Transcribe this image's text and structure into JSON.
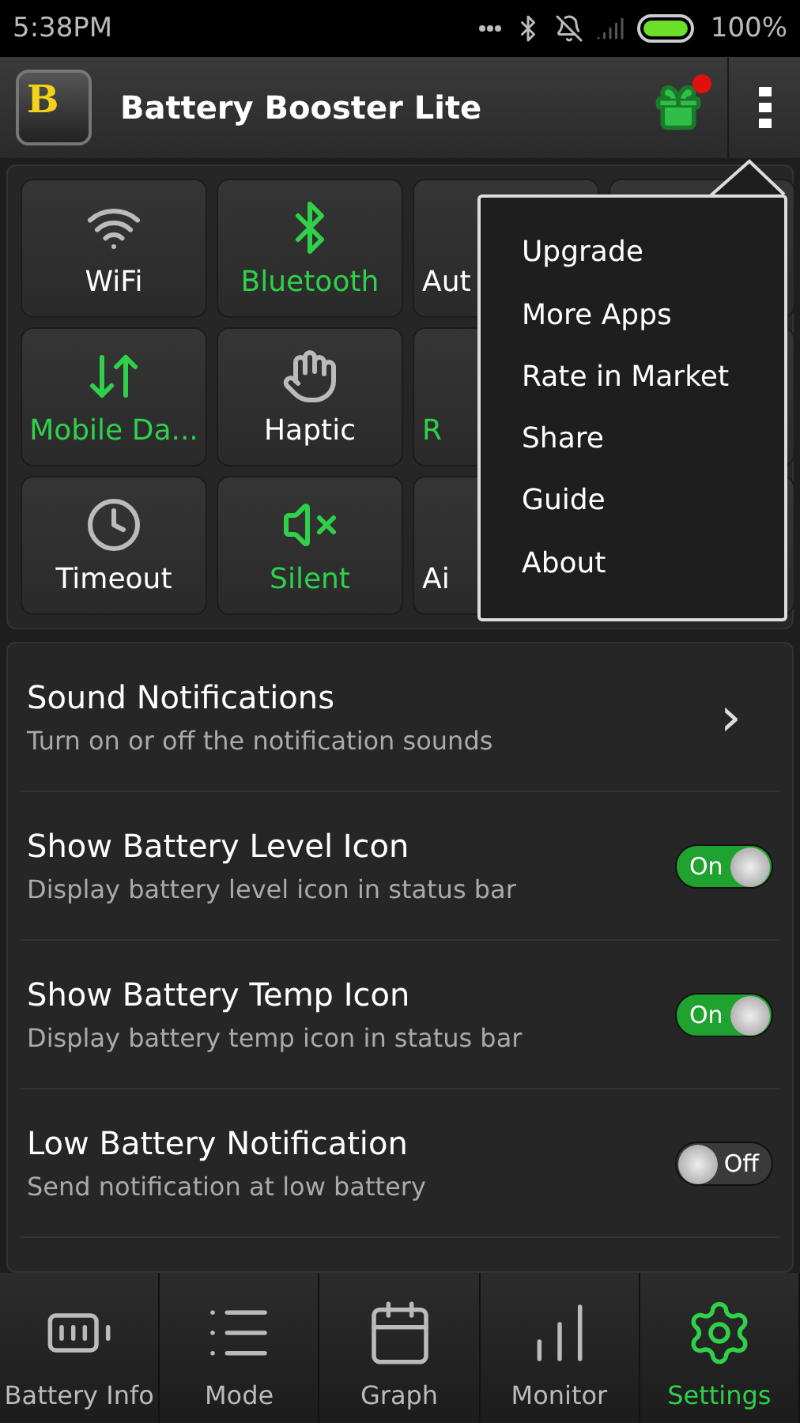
{
  "status_bar": {
    "time": "5:38PM",
    "battery": "100%"
  },
  "app_bar": {
    "logo_letter": "B",
    "title": "Battery Booster Lite",
    "gift_badge": true
  },
  "toggles": [
    {
      "label": "WiFi",
      "on": false
    },
    {
      "label": "Bluetooth",
      "on": true
    },
    {
      "label": "Aut",
      "on": false
    },
    {
      "label": "Mobile Da...",
      "on": true
    },
    {
      "label": "Haptic",
      "on": false
    },
    {
      "label": "R",
      "on": true
    },
    {
      "label": "Timeout",
      "on": false
    },
    {
      "label": "Silent",
      "on": true
    },
    {
      "label": "Ai",
      "on": false
    }
  ],
  "menu": {
    "items": [
      "Upgrade",
      "More Apps",
      "Rate in Market",
      "Share",
      "Guide",
      "About"
    ]
  },
  "settings": [
    {
      "kind": "link",
      "title": "Sound Notifications",
      "subtitle": "Turn on or off the notification sounds",
      "chevron": "›"
    },
    {
      "kind": "switch",
      "title": "Show Battery Level Icon",
      "subtitle": "Display battery level icon in status bar",
      "on": true,
      "switch_label": "On"
    },
    {
      "kind": "switch",
      "title": "Show Battery Temp Icon",
      "subtitle": "Display battery temp icon in status bar",
      "on": true,
      "switch_label": "On"
    },
    {
      "kind": "switch",
      "title": "Low Battery Notification",
      "subtitle": "Send notification at low battery",
      "on": false,
      "switch_label": "Off"
    }
  ],
  "tabs": [
    {
      "label": "Battery Info",
      "selected": false
    },
    {
      "label": "Mode",
      "selected": false
    },
    {
      "label": "Graph",
      "selected": false
    },
    {
      "label": "Monitor",
      "selected": false
    },
    {
      "label": "Settings",
      "selected": true
    }
  ]
}
